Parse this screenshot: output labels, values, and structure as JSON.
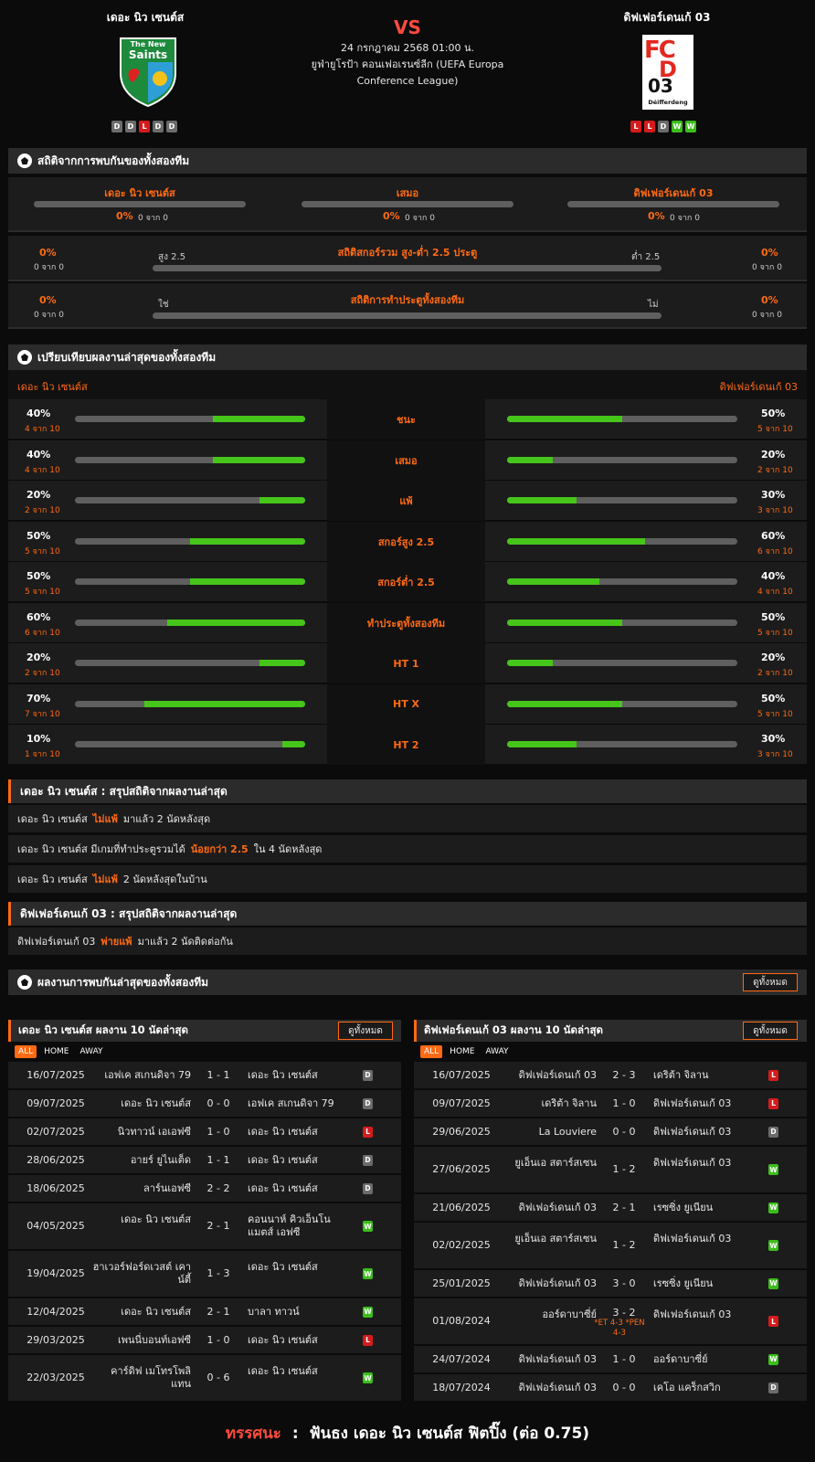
{
  "home": {
    "name": "เดอะ นิว เซนต์ส",
    "logo_text_1": "The New",
    "logo_text_2": "Saints",
    "form": [
      "D",
      "D",
      "L",
      "D",
      "D"
    ]
  },
  "away": {
    "name": "ดิฟเฟอร์เดนเก้ 03",
    "logo_text_1": "FC",
    "logo_text_2": "D",
    "logo_text_3": "03",
    "logo_text_4": "Déifferdeng",
    "form": [
      "L",
      "L",
      "D",
      "W",
      "W"
    ]
  },
  "vs": "VS",
  "match": {
    "datetime": "24 กรกฎาคม 2568 01:00 น.",
    "competition_1": "ยูฟ่ายูโรป้า คอนเฟอเรนซ์ลีก (UEFA Europa",
    "competition_2": "Conference League)"
  },
  "h2h": {
    "title": "สถิติจากการพบกันของทั้งสองทีม",
    "cols": [
      {
        "label": "เดอะ นิว เซนต์ส",
        "pct": "0%",
        "sub": "0 จาก 0"
      },
      {
        "label": "เสมอ",
        "pct": "0%",
        "sub": "0 จาก 0"
      },
      {
        "label": "ดิฟเฟอร์เดนเก้ 03",
        "pct": "0%",
        "sub": "0 จาก 0"
      }
    ],
    "ou": {
      "title": "สถิติสกอร์รวม สูง-ต่ำ 2.5 ประตู",
      "left_label": "สูง 2.5",
      "right_label": "ต่ำ 2.5",
      "left_pct": "0%",
      "left_sub": "0 จาก 0",
      "right_pct": "0%",
      "right_sub": "0 จาก 0"
    },
    "btts": {
      "title": "สถิติการทำประตูทั้งสองทีม",
      "left_label": "ใช่",
      "right_label": "ไม่",
      "left_pct": "0%",
      "left_sub": "0 จาก 0",
      "right_pct": "0%",
      "right_sub": "0 จาก 0"
    }
  },
  "compare": {
    "title": "เปรียบเทียบผลงานล่าสุดของทั้งสองทีม",
    "home_label": "เดอะ นิว เซนต์ส",
    "away_label": "ดิฟเฟอร์เดนเก้ 03",
    "rows": [
      {
        "label": "ชนะ",
        "home_pct": "40%",
        "home_sub": "4 จาก 10",
        "home_val": 40,
        "away_pct": "50%",
        "away_sub": "5 จาก 10",
        "away_val": 50
      },
      {
        "label": "เสมอ",
        "home_pct": "40%",
        "home_sub": "4 จาก 10",
        "home_val": 40,
        "away_pct": "20%",
        "away_sub": "2 จาก 10",
        "away_val": 20
      },
      {
        "label": "แพ้",
        "home_pct": "20%",
        "home_sub": "2 จาก 10",
        "home_val": 20,
        "away_pct": "30%",
        "away_sub": "3 จาก 10",
        "away_val": 30
      },
      {
        "label": "สกอร์สูง 2.5",
        "home_pct": "50%",
        "home_sub": "5 จาก 10",
        "home_val": 50,
        "away_pct": "60%",
        "away_sub": "6 จาก 10",
        "away_val": 60
      },
      {
        "label": "สกอร์ต่ำ 2.5",
        "home_pct": "50%",
        "home_sub": "5 จาก 10",
        "home_val": 50,
        "away_pct": "40%",
        "away_sub": "4 จาก 10",
        "away_val": 40
      },
      {
        "label": "ทำประตูทั้งสองทีม",
        "home_pct": "60%",
        "home_sub": "6 จาก 10",
        "home_val": 60,
        "away_pct": "50%",
        "away_sub": "5 จาก 10",
        "away_val": 50
      },
      {
        "label": "HT 1",
        "home_pct": "20%",
        "home_sub": "2 จาก 10",
        "home_val": 20,
        "away_pct": "20%",
        "away_sub": "2 จาก 10",
        "away_val": 20
      },
      {
        "label": "HT X",
        "home_pct": "70%",
        "home_sub": "7 จาก 10",
        "home_val": 70,
        "away_pct": "50%",
        "away_sub": "5 จาก 10",
        "away_val": 50
      },
      {
        "label": "HT 2",
        "home_pct": "10%",
        "home_sub": "1 จาก 10",
        "home_val": 10,
        "away_pct": "30%",
        "away_sub": "3 จาก 10",
        "away_val": 30
      }
    ]
  },
  "summary_home": {
    "title": "เดอะ นิว เซนต์ส : สรุปสถิติจากผลงานล่าสุด",
    "lines": [
      {
        "a": "เดอะ นิว เซนต์ส",
        "b": "ไม่แพ้",
        "c": "มาแล้ว 2 นัดหลังสุด"
      },
      {
        "a": "เดอะ นิว เซนต์ส มีเกมที่ทำประตูรวมได้",
        "b": "น้อยกว่า 2.5",
        "c": "ใน 4 นัดหลังสุด"
      },
      {
        "a": "เดอะ นิว เซนต์ส",
        "b": "ไม่แพ้",
        "c": "2 นัดหลังสุดในบ้าน"
      }
    ]
  },
  "summary_away": {
    "title": "ดิฟเฟอร์เดนเก้ 03 : สรุปสถิติจากผลงานล่าสุด",
    "lines": [
      {
        "a": "ดิฟเฟอร์เดนเก้ 03",
        "b": "พ่ายแพ้",
        "c": "มาแล้ว 2 นัดติดต่อกัน"
      }
    ]
  },
  "h2h_results": {
    "title": "ผลงานการพบกันล่าสุดของทั้งสองทีม",
    "view_all": "ดูทั้งหมด"
  },
  "home_last": {
    "title": "เดอะ นิว เซนต์ส ผลงาน 10 นัดล่าสุด",
    "view_all": "ดูทั้งหมด",
    "tabs": [
      "ALL",
      "HOME",
      "AWAY"
    ],
    "matches": [
      {
        "date": "16/07/2025",
        "home": "เอฟเค สเกนดิจา 79",
        "score": "1 - 1",
        "away": "เดอะ นิว เซนต์ส",
        "r": "D"
      },
      {
        "date": "09/07/2025",
        "home": "เดอะ นิว เซนต์ส",
        "score": "0 - 0",
        "away": "เอฟเค สเกนดิจา 79",
        "r": "D"
      },
      {
        "date": "02/07/2025",
        "home": "นิวทาวน์ เอเอฟซี",
        "score": "1 - 0",
        "away": "เดอะ นิว เซนต์ส",
        "r": "L"
      },
      {
        "date": "28/06/2025",
        "home": "อายร์ ยูไนเต็ด",
        "score": "1 - 1",
        "away": "เดอะ นิว เซนต์ส",
        "r": "D"
      },
      {
        "date": "18/06/2025",
        "home": "ลาร์นเอฟซี",
        "score": "2 - 2",
        "away": "เดอะ นิว เซนต์ส",
        "r": "D"
      },
      {
        "date": "04/05/2025",
        "home": "เดอะ นิว เซนต์ส",
        "score": "2 - 1",
        "away": "คอนนาห์ คิวเอ็นโน แมตส์ เอฟซี",
        "r": "W"
      },
      {
        "date": "19/04/2025",
        "home": "ฮาเวอร์ฟอร์ดเวสต์ เคาน์ตี้",
        "score": "1 - 3",
        "away": "เดอะ นิว เซนต์ส",
        "r": "W"
      },
      {
        "date": "12/04/2025",
        "home": "เดอะ นิว เซนต์ส",
        "score": "2 - 1",
        "away": "บาลา ทาวน์",
        "r": "W"
      },
      {
        "date": "29/03/2025",
        "home": "เพนนี่บอนท์เอฟซี",
        "score": "1 - 0",
        "away": "เดอะ นิว เซนต์ส",
        "r": "L"
      },
      {
        "date": "22/03/2025",
        "home": "คาร์ดิฟ เมโทรโพลิแทน",
        "score": "0 - 6",
        "away": "เดอะ นิว เซนต์ส",
        "r": "W"
      }
    ]
  },
  "away_last": {
    "title": "ดิฟเฟอร์เดนเก้ 03 ผลงาน 10 นัดล่าสุด",
    "view_all": "ดูทั้งหมด",
    "tabs": [
      "ALL",
      "HOME",
      "AWAY"
    ],
    "matches": [
      {
        "date": "16/07/2025",
        "home": "ดิฟเฟอร์เดนเก้ 03",
        "score": "2 - 3",
        "away": "เดริต้า จิลาน",
        "r": "L"
      },
      {
        "date": "09/07/2025",
        "home": "เดริต้า จิลาน",
        "score": "1 - 0",
        "away": "ดิฟเฟอร์เดนเก้ 03",
        "r": "L"
      },
      {
        "date": "29/06/2025",
        "home": "La Louviere",
        "score": "0 - 0",
        "away": "ดิฟเฟอร์เดนเก้ 03",
        "r": "D"
      },
      {
        "date": "27/06/2025",
        "home": "ยูเอ็นเอ สตาร์สเซน",
        "score": "1 - 2",
        "away": "ดิฟเฟอร์เดนเก้ 03",
        "r": "W"
      },
      {
        "date": "21/06/2025",
        "home": "ดิฟเฟอร์เดนเก้ 03",
        "score": "2 - 1",
        "away": "เรซซิ่ง ยูเนียน",
        "r": "W"
      },
      {
        "date": "02/02/2025",
        "home": "ยูเอ็นเอ สตาร์สเซน",
        "score": "1 - 2",
        "away": "ดิฟเฟอร์เดนเก้ 03",
        "r": "W"
      },
      {
        "date": "25/01/2025",
        "home": "ดิฟเฟอร์เดนเก้ 03",
        "score": "3 - 0",
        "away": "เรซซิ่ง ยูเนียน",
        "r": "W"
      },
      {
        "date": "01/08/2024",
        "home": "ออร์ดาบาซี่ย์",
        "score": "3 - 2",
        "score_note": "*ET 4-3 *PEN 4-3",
        "away": "ดิฟเฟอร์เดนเก้ 03",
        "r": "L"
      },
      {
        "date": "24/07/2024",
        "home": "ดิฟเฟอร์เดนเก้ 03",
        "score": "1 - 0",
        "away": "ออร์ดาบาซี่ย์",
        "r": "W"
      },
      {
        "date": "18/07/2024",
        "home": "ดิฟเฟอร์เดนเก้ 03",
        "score": "0 - 0",
        "away": "เคโอ แคร็กสวิก",
        "r": "D"
      }
    ]
  },
  "prediction": {
    "label": "ทรรศนะ",
    "sep": ":",
    "text": "ฟันธง เดอะ นิว เซนต์ส ฟิตปิ๊ง (ต่อ 0.75)"
  },
  "colors": {
    "accent": "#ff6a14",
    "win": "#3bbd1b",
    "loss": "#d41c1c",
    "draw": "#6b6b6b",
    "bar_fill": "#46c51a",
    "vs": "#ff4b3e"
  }
}
